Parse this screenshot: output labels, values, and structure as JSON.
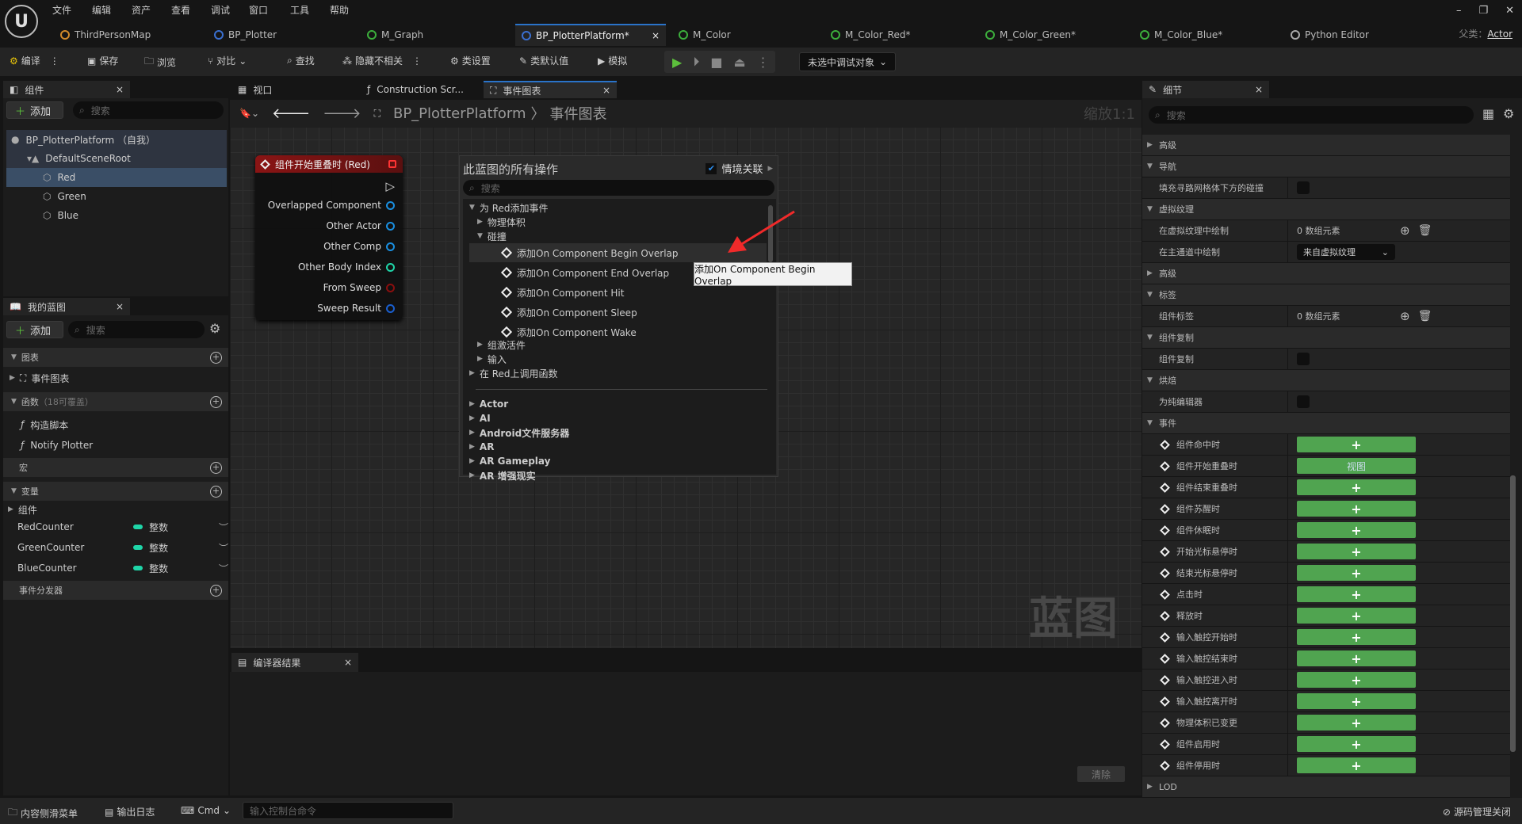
{
  "menu": [
    "文件",
    "编辑",
    "资产",
    "查看",
    "调试",
    "窗口",
    "工具",
    "帮助"
  ],
  "doc_tabs": [
    {
      "label": "ThirdPersonMap",
      "color": "#d08a2a"
    },
    {
      "label": "BP_Plotter",
      "color": "#3a6fd0"
    },
    {
      "label": "M_Graph",
      "color": "#3cae3c"
    },
    {
      "label": "BP_PlotterPlatform*",
      "color": "#3a6fd0",
      "active": true
    },
    {
      "label": "M_Color",
      "color": "#3cae3c"
    },
    {
      "label": "M_Color_Red*",
      "color": "#3cae3c"
    },
    {
      "label": "M_Color_Green*",
      "color": "#3cae3c"
    },
    {
      "label": "M_Color_Blue*",
      "color": "#3cae3c"
    },
    {
      "label": "Python Editor",
      "color": "#aaaaaa"
    }
  ],
  "parent_class": {
    "label": "父类：",
    "value": "Actor"
  },
  "toolbar": {
    "compile": "编译",
    "save": "保存",
    "browse": "浏览",
    "diff": "对比",
    "find": "查找",
    "hide_unrelated": "隐藏不相关",
    "class_settings": "类设置",
    "class_defaults": "类默认值",
    "simulate": "模拟",
    "debug_target": "未选中调试对象"
  },
  "components": {
    "tab": "组件",
    "add": "添加",
    "search_placeholder": "搜索",
    "tree": [
      "BP_PlotterPlatform （自我）",
      "DefaultSceneRoot",
      "Red",
      "Green",
      "Blue"
    ],
    "selected": "Red"
  },
  "my_blueprint": {
    "tab": "我的蓝图",
    "add": "添加",
    "search_placeholder": "搜索",
    "graphs": "图表",
    "event_graph": "事件图表",
    "functions": "函数",
    "functions_note": "（18可覆盖）",
    "construction": "构造脚本",
    "notify": "Notify Plotter",
    "macros": "宏",
    "variables": "变量",
    "var_group": "组件",
    "vars": [
      {
        "name": "RedCounter",
        "type": "整数"
      },
      {
        "name": "GreenCounter",
        "type": "整数"
      },
      {
        "name": "BlueCounter",
        "type": "整数"
      }
    ],
    "dispatchers": "事件分发器",
    "type_color": "#1fd5a8"
  },
  "graph_tabs": [
    "视口",
    "Construction Scr...",
    "事件图表"
  ],
  "breadcrumb": {
    "root": "BP_PlotterPlatform",
    "sep": "〉",
    "current": "事件图表",
    "zoom": "缩放1:1"
  },
  "watermark": "蓝图",
  "node": {
    "title": "组件开始重叠时 (Red)",
    "pins": [
      {
        "label": "Overlapped Component",
        "color": "#1a8fe0"
      },
      {
        "label": "Other Actor",
        "color": "#1a8fe0"
      },
      {
        "label": "Other Comp",
        "color": "#1a8fe0"
      },
      {
        "label": "Other Body Index",
        "color": "#1fd5a8"
      },
      {
        "label": "From Sweep",
        "color": "#8a0f0f"
      },
      {
        "label": "Sweep Result",
        "color": "#1a5fd0"
      }
    ]
  },
  "action_menu": {
    "title": "此蓝图的所有操作",
    "context": "情境关联",
    "search_placeholder": "搜索",
    "items": [
      {
        "label": "为 Red添加事件",
        "level": 0,
        "open": true
      },
      {
        "label": "物理体积",
        "level": 1
      },
      {
        "label": "碰撞",
        "level": 1,
        "open": true
      },
      {
        "label": "添加On Component Begin Overlap",
        "level": 2,
        "event": true,
        "hover": true
      },
      {
        "label": "添加On Component End Overlap",
        "level": 2,
        "event": true
      },
      {
        "label": "添加On Component Hit",
        "level": 2,
        "event": true
      },
      {
        "label": "添加On Component Sleep",
        "level": 2,
        "event": true
      },
      {
        "label": "添加On Component Wake",
        "level": 2,
        "event": true
      },
      {
        "label": "组激活件",
        "level": 1
      },
      {
        "label": "输入",
        "level": 1
      },
      {
        "label": "在 Red上调用函数",
        "level": 0
      }
    ],
    "categories": [
      "Actor",
      "AI",
      "Android文件服务器",
      "AR",
      "AR Gameplay",
      "AR 增强现实"
    ],
    "tooltip": "添加On Component Begin Overlap"
  },
  "compiler": {
    "tab": "编译器结果",
    "clear": "清除"
  },
  "details": {
    "tab": "细节",
    "search_placeholder": "搜索",
    "rows": [
      {
        "t": "hdr",
        "label": "高级",
        "open": false
      },
      {
        "t": "hdr",
        "label": "导航",
        "open": true
      },
      {
        "t": "check",
        "label": "填充寻路网格体下方的碰撞"
      },
      {
        "t": "hdr",
        "label": "虚拟纹理",
        "open": true
      },
      {
        "t": "array",
        "label": "在虚拟纹理中绘制",
        "value": "0 数组元素"
      },
      {
        "t": "combo",
        "label": "在主通道中绘制",
        "value": "来自虚拟纹理"
      },
      {
        "t": "hdr",
        "label": "高级",
        "open": false
      },
      {
        "t": "hdr",
        "label": "标签",
        "open": true
      },
      {
        "t": "array",
        "label": "组件标签",
        "value": "0 数组元素"
      },
      {
        "t": "hdr",
        "label": "组件复制",
        "open": true
      },
      {
        "t": "check",
        "label": "组件复制"
      },
      {
        "t": "hdr",
        "label": "烘焙",
        "open": true
      },
      {
        "t": "check",
        "label": "为纯编辑器"
      },
      {
        "t": "hdr",
        "label": "事件",
        "open": true
      },
      {
        "t": "event",
        "label": "组件命中时"
      },
      {
        "t": "event",
        "label": "组件开始重叠时",
        "value": "视图"
      },
      {
        "t": "event",
        "label": "组件结束重叠时"
      },
      {
        "t": "event",
        "label": "组件苏醒时"
      },
      {
        "t": "event",
        "label": "组件休眠时"
      },
      {
        "t": "event",
        "label": "开始光标悬停时"
      },
      {
        "t": "event",
        "label": "结束光标悬停时"
      },
      {
        "t": "event",
        "label": "点击时"
      },
      {
        "t": "event",
        "label": "释放时"
      },
      {
        "t": "event",
        "label": "输入触控开始时"
      },
      {
        "t": "event",
        "label": "输入触控结束时"
      },
      {
        "t": "event",
        "label": "输入触控进入时"
      },
      {
        "t": "event",
        "label": "输入触控离开时"
      },
      {
        "t": "event",
        "label": "物理体积已变更"
      },
      {
        "t": "event",
        "label": "组件启用时"
      },
      {
        "t": "event",
        "label": "组件停用时"
      },
      {
        "t": "hdr",
        "label": "LOD",
        "open": false
      }
    ]
  },
  "statusbar": {
    "content_drawer": "内容侧滑菜单",
    "output_log": "输出日志",
    "cmd": "Cmd",
    "console_placeholder": "输入控制台命令",
    "source_control": "源码管理关闭"
  }
}
